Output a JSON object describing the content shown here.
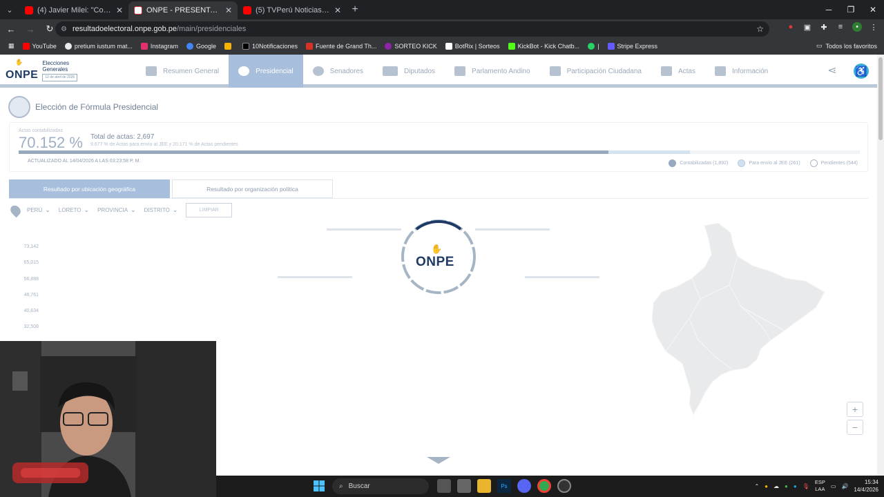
{
  "browser": {
    "tabs": [
      {
        "title": "(4) Javier Milei: \"Con la izquierd",
        "favicon": "youtube-icon",
        "active": false
      },
      {
        "title": "ONPE - PRESENTACIÓN DE RES",
        "favicon": "onpe-icon",
        "active": true
      },
      {
        "title": "(5) TVPerú Noticias EN VIVO: N",
        "favicon": "youtube-icon",
        "active": false
      }
    ],
    "url_host": "resultadoelectoral.onpe.gob.pe",
    "url_path": "/main/presidenciales",
    "bookmarks": [
      {
        "label": "YouTube",
        "color": "#ff0000"
      },
      {
        "label": "pretium iustum mat...",
        "color": "#e8eaed"
      },
      {
        "label": "Instagram",
        "color": "#e1306c"
      },
      {
        "label": "Google",
        "color": "#4285f4"
      },
      {
        "label": "",
        "color": "#f4b400"
      },
      {
        "label": "10Notificaciones",
        "color": "#000000"
      },
      {
        "label": "Fuente de Grand Th...",
        "color": "#d93025"
      },
      {
        "label": "SORTEO KICK",
        "color": "#8e24aa"
      },
      {
        "label": "BotRix | Sorteos",
        "color": "#ffffff"
      },
      {
        "label": "KickBot - Kick Chatb...",
        "color": "#53fc18"
      },
      {
        "label": "|",
        "color": "#25d366"
      },
      {
        "label": "Stripe Express",
        "color": "#635bff"
      }
    ],
    "all_bookmarks_label": "Todos los favoritos"
  },
  "site": {
    "brand": "ONPE",
    "subtitle_line1": "Elecciones",
    "subtitle_line2": "Generales",
    "subtitle_date": "12 de abril de 2026",
    "nav": [
      {
        "label": "Resumen General",
        "active": false
      },
      {
        "label": "Presidencial",
        "active": true
      },
      {
        "label": "Senadores",
        "active": false
      },
      {
        "label": "Diputados",
        "active": false
      },
      {
        "label": "Parlamento Andino",
        "active": false
      },
      {
        "label": "Participación Ciudadana",
        "active": false
      },
      {
        "label": "Actas",
        "active": false
      },
      {
        "label": "Información",
        "active": false
      }
    ]
  },
  "main": {
    "title": "Elección de Fórmula Presidencial",
    "summary": {
      "label": "Actas contabilizadas",
      "percent": "70.152 %",
      "percent_value": 70.152,
      "total": "Total de actas: 2,697",
      "detail": "9.677 % de Actas para envío al JEE y 20.171 % de Actas pendientes",
      "jee_value": 9.677,
      "updated": "ACTUALIZADO AL 14/04/2026 A LAS 03:23:58 p. m.",
      "legend": [
        {
          "label": "Contabilizadas (1,892)",
          "color": "#97a9bf"
        },
        {
          "label": "Para envío al JEE (261)",
          "color": "#cfe0f0"
        },
        {
          "label": "Pendientes (544)",
          "color": "#ffffff"
        }
      ]
    },
    "tabs": [
      {
        "label": "Resultado por ubicación geográfica",
        "active": true
      },
      {
        "label": "Resultado por organización política",
        "active": false
      }
    ],
    "filters": {
      "country": "PERÚ",
      "department": "LORETO",
      "province": "PROVINCIA",
      "district": "DISTRITO",
      "clear_label": "LIMPIAR"
    },
    "y_axis_ticks": [
      "73,142",
      "65,015",
      "56,888",
      "48,761",
      "40,634",
      "32,508"
    ],
    "loader_brand": "ONPE",
    "zoom_in": "+",
    "zoom_out": "−"
  },
  "taskbar": {
    "search_placeholder": "Buscar",
    "lang_line1": "ESP",
    "lang_line2": "LAA",
    "time": "15:34",
    "date": "14/4/2026"
  }
}
